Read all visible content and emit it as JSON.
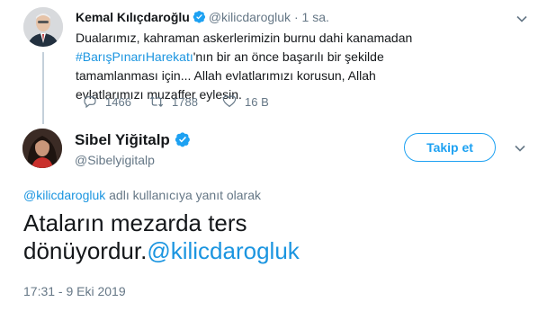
{
  "parent_tweet": {
    "author_name": "Kemal Kılıçdaroğlu",
    "handle": "@kilicdarogluk",
    "separator": "·",
    "time": "1 sa.",
    "text_part1": "Dualarımız, kahraman askerlerimizin burnu dahi kanamadan ",
    "hashtag": "#BarışPınarıHarekatı",
    "text_part2": "'nın bir an önce başarılı bir şekilde tamamlanması için... Allah evlatlarımızı korusun, Allah evlatlarımızı muzaffer eylesin.",
    "reply_count": "1466",
    "retweet_count": "1788",
    "like_count": "16 B"
  },
  "main_tweet": {
    "author_name": "Sibel Yiğitalp",
    "handle": "@Sibelyigitalp",
    "follow_label": "Takip et",
    "reply_to_handle": "@kilicdarogluk",
    "reply_to_suffix": " adlı kullanıcıya yanıt olarak",
    "text": "Ataların mezarda ters dönüyordur.",
    "mention": "@kilicdarogluk",
    "timestamp": "17:31 - 9 Eki 2019"
  },
  "colors": {
    "link": "#1b95e0",
    "verified": "#1da1f2",
    "muted": "#657786",
    "text": "#14171a"
  },
  "icons": {
    "verified": "verified-badge-icon",
    "reply": "reply-icon",
    "retweet": "retweet-icon",
    "like": "heart-icon",
    "menu": "chevron-down-icon"
  }
}
